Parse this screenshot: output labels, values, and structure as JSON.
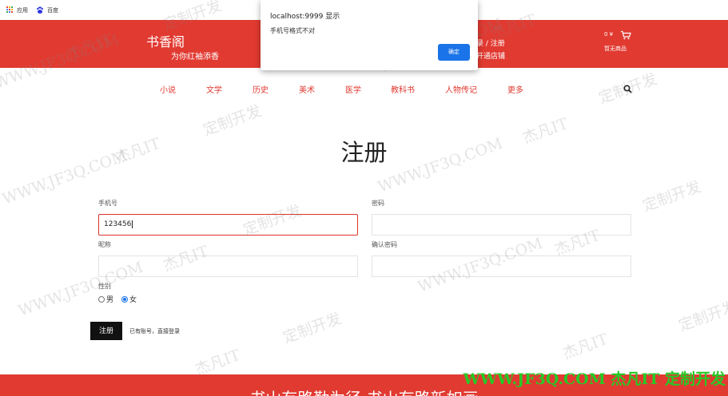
{
  "bookmarks": [
    {
      "label": "应用",
      "icon": "apps-grid-icon"
    },
    {
      "label": "百度",
      "icon": "baidu-paw-icon"
    }
  ],
  "header": {
    "logo_title": "书香阁",
    "logo_slogan": "为你红袖添香",
    "auth_links": "录 / 注册",
    "shop_link": "开通店铺",
    "cart_amount": "0 ¥",
    "cart_icon": "shopping-cart-icon",
    "cart_empty": "暂无商品",
    "bg_color": "#e13a31"
  },
  "nav": {
    "items": [
      "小说",
      "文学",
      "历史",
      "美术",
      "医学",
      "教科书",
      "人物传记",
      "更多"
    ],
    "search_icon": "search-icon",
    "color": "#e13a31"
  },
  "form": {
    "title": "注册",
    "phone_label": "手机号",
    "phone_value": "123456",
    "password_label": "密码",
    "nickname_label": "昵称",
    "confirm_label": "确认密码",
    "gender_label": "性别",
    "gender_male": "男",
    "gender_female": "女",
    "gender_selected": "女",
    "register_button": "注册",
    "login_link": "已有账号，直接登录"
  },
  "alert": {
    "title": "localhost:9999 显示",
    "message": "手机号格式不对",
    "ok_button": "确定",
    "accent": "#1a73e8"
  },
  "footer": {
    "text": "书山有路勤为径 书山有路新如画"
  },
  "watermarks": {
    "site": "WWW.JF3Q.COM",
    "brand": "杰凡IT",
    "slogan": "定制开发",
    "corner": "WWW.JF3Q.COM 杰凡IT  定制开发",
    "corner_color": "#26c926"
  }
}
